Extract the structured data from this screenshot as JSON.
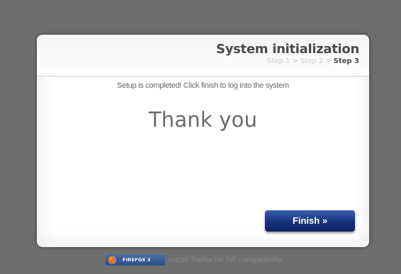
{
  "dialog": {
    "title": "System initialization",
    "steps": {
      "step1": "Step 1",
      "step2": "Step 2",
      "step3": "Step 3",
      "separator": ">"
    },
    "message": "Setup is completed! Click finish to log into the system",
    "headline": "Thank you",
    "finish_label": "Finish »"
  },
  "footer": {
    "badge_label": "FIREFOX 3",
    "text": "Install firefox for full compatibility"
  },
  "colors": {
    "background": "#6e6e6e",
    "button": "#16337a",
    "title": "#4a4a4a",
    "inactive_step": "#c8c8c8"
  },
  "icons": {
    "firefox": "firefox-logo-icon"
  }
}
